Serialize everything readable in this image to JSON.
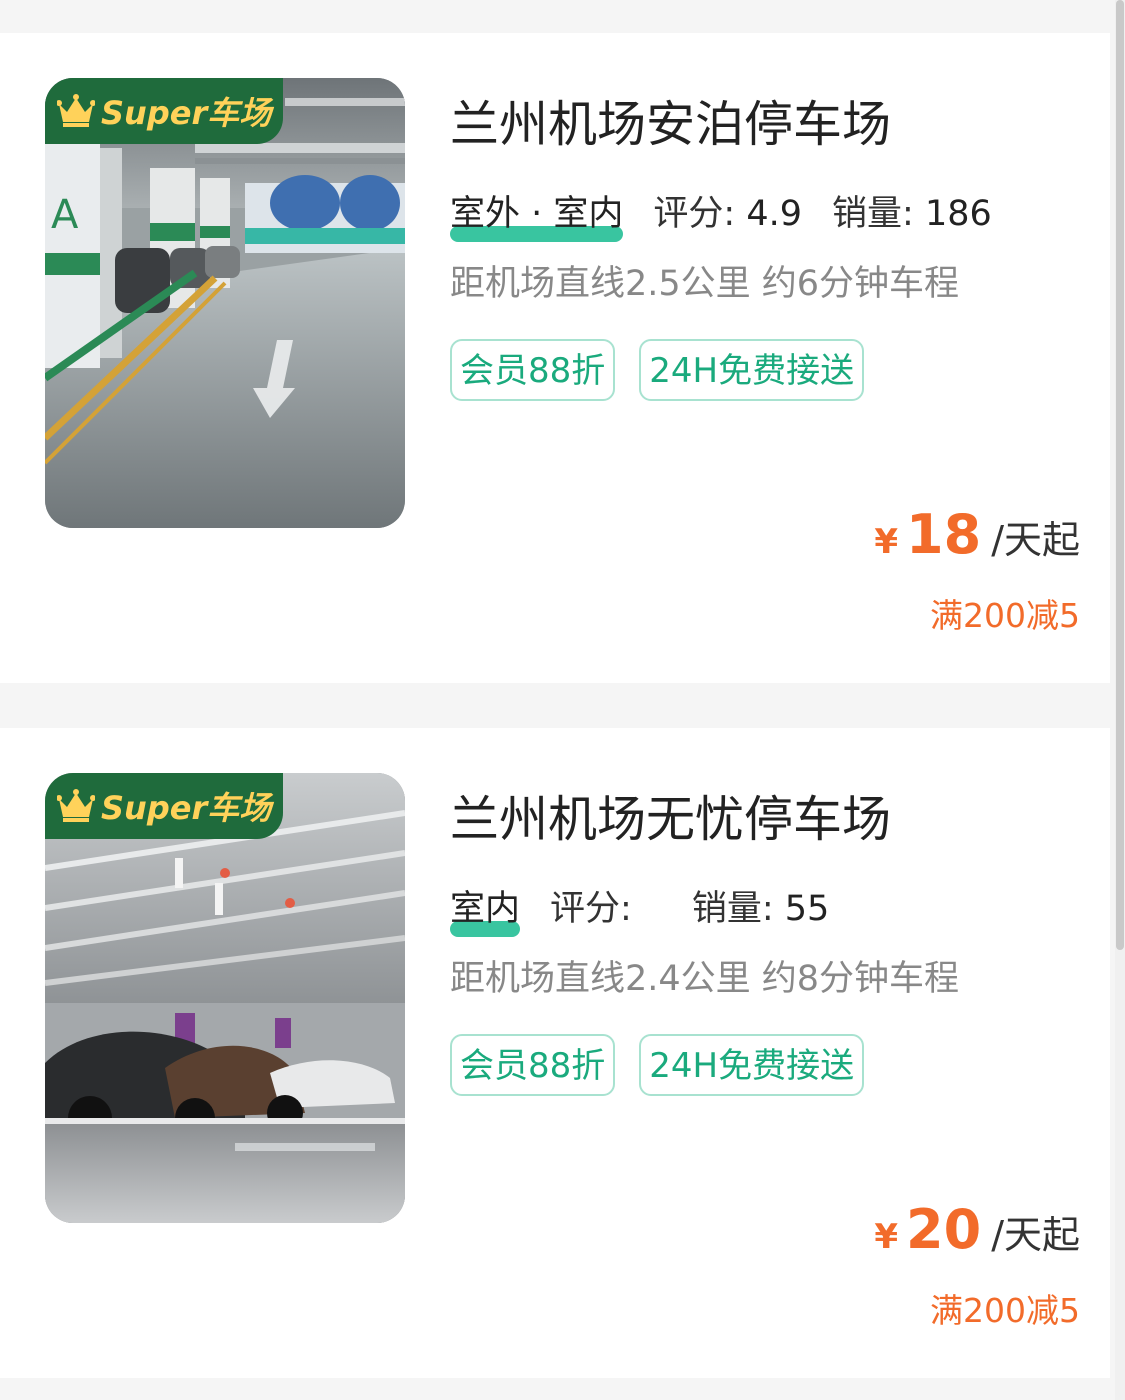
{
  "badge": {
    "brand_latin": "Super",
    "brand_cn": "车场",
    "icon": "crown-icon"
  },
  "colors": {
    "accent_green": "#1aaa7d",
    "badge_green": "#1f6b3c",
    "badge_gold": "#ffd25a",
    "price_orange": "#f26b2a"
  },
  "lots": [
    {
      "name": "兰州机场安泊停车场",
      "type": "室外 · 室内",
      "rating_label": "评分:",
      "rating_value": "4.9",
      "sales_label": "销量:",
      "sales_value": "186",
      "distance": "距机场直线2.5公里 约6分钟车程",
      "tags": [
        "会员88折",
        "24H免费接送"
      ],
      "price_symbol": "¥",
      "price": "18",
      "price_unit": "/天起",
      "promo": "满200减5"
    },
    {
      "name": "兰州机场无忧停车场",
      "type": "室内",
      "rating_label": "评分:",
      "rating_value": "",
      "sales_label": "销量:",
      "sales_value": "55",
      "distance": "距机场直线2.4公里 约8分钟车程",
      "tags": [
        "会员88折",
        "24H免费接送"
      ],
      "price_symbol": "¥",
      "price": "20",
      "price_unit": "/天起",
      "promo": "满200减5"
    }
  ]
}
